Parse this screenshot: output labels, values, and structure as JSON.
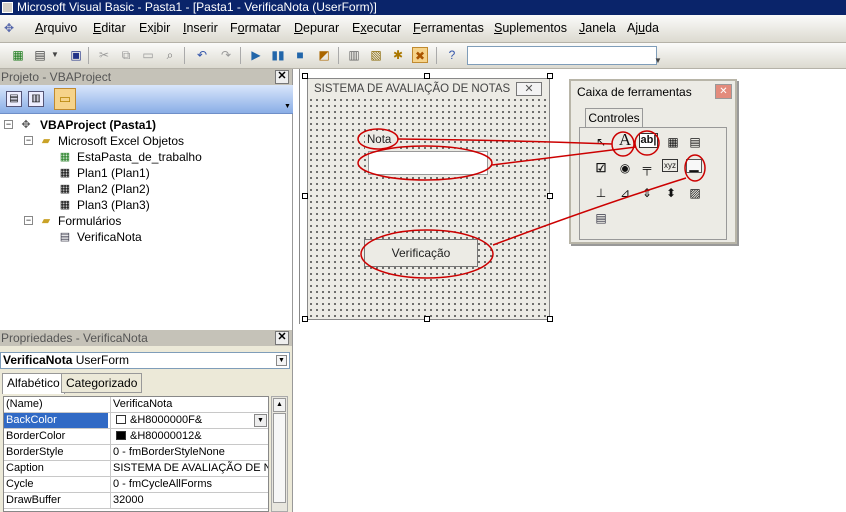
{
  "window": {
    "title": "Microsoft Visual Basic - Pasta1 - [Pasta1 - VerificaNota (UserForm)]"
  },
  "menu": [
    {
      "label": "Arquivo",
      "ul": "A"
    },
    {
      "label": "Editar",
      "ul": "E"
    },
    {
      "label": "Exibir",
      "ul": "i"
    },
    {
      "label": "Inserir",
      "ul": "I"
    },
    {
      "label": "Formatar",
      "ul": "o"
    },
    {
      "label": "Depurar",
      "ul": "D"
    },
    {
      "label": "Executar",
      "ul": "x"
    },
    {
      "label": "Ferramentas",
      "ul": "F"
    },
    {
      "label": "Suplementos",
      "ul": "S"
    },
    {
      "label": "Janela",
      "ul": "J"
    },
    {
      "label": "Ajuda",
      "ul": "u"
    }
  ],
  "project": {
    "title": "Projeto - VBAProject",
    "root": "VBAProject (Pasta1)",
    "excel_folder": "Microsoft Excel Objetos",
    "excel_items": [
      "EstaPasta_de_trabalho",
      "Plan1 (Plan1)",
      "Plan2 (Plan2)",
      "Plan3 (Plan3)"
    ],
    "forms_folder": "Formulários",
    "form_item": "VerificaNota"
  },
  "properties": {
    "title": "Propriedades - VerificaNota",
    "object_name": "VerificaNota",
    "object_type": "UserForm",
    "tabs": [
      "Alfabético",
      "Categorizado"
    ],
    "rows": [
      {
        "name": "(Name)",
        "value": "VerificaNota"
      },
      {
        "name": "BackColor",
        "value": "&H8000000F&",
        "swatch": "#ffffff"
      },
      {
        "name": "BorderColor",
        "value": "&H80000012&",
        "swatch": "#000000"
      },
      {
        "name": "BorderStyle",
        "value": "0 - fmBorderStyleNone"
      },
      {
        "name": "Caption",
        "value": "SISTEMA DE AVALIAÇÃO DE NOT"
      },
      {
        "name": "Cycle",
        "value": "0 - fmCycleAllForms"
      },
      {
        "name": "DrawBuffer",
        "value": "32000"
      }
    ]
  },
  "userform": {
    "caption": "SISTEMA DE AVALIAÇÃO DE NOTAS",
    "label": "Nota",
    "button": "Verificação"
  },
  "toolbox": {
    "title": "Caixa de ferramentas",
    "tab": "Controles"
  },
  "colors": {
    "titlebar": "#0a246a",
    "selection": "#316ac5",
    "annotation": "#cc0000"
  }
}
